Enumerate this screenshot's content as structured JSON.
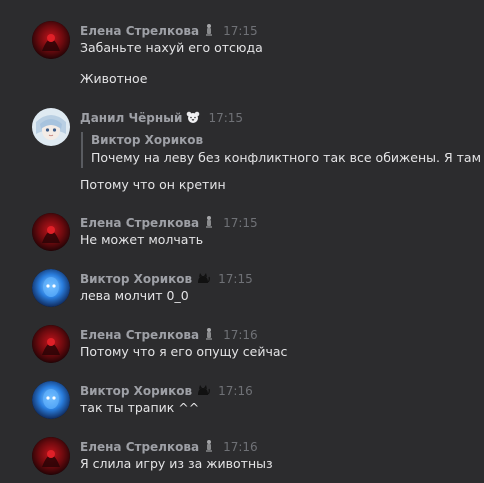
{
  "messages": [
    {
      "author": "Елена Стрелкова",
      "author_icon": "figurine-emoji",
      "time": "17:15",
      "avatar": "dark-red-hooded-figure-avatar",
      "lines": [
        "Забаньте нахуй его отсюда",
        "Животное"
      ]
    },
    {
      "author": "Данил Чёрный",
      "author_icon": "bear-face-emoji",
      "time": "17:15",
      "avatar": "anime-character-avatar",
      "reply": {
        "author": "Виктор Хориков",
        "text": "Почему на леву без конфликтного так все обижены. Я там ..."
      },
      "lines": [
        "Потому что он кретин"
      ]
    },
    {
      "author": "Елена Стрелкова",
      "author_icon": "figurine-emoji",
      "time": "17:15",
      "avatar": "dark-red-hooded-figure-avatar",
      "lines": [
        "Не может молчать"
      ]
    },
    {
      "author": "Виктор Хориков",
      "author_icon": "black-cat-emoji",
      "time": "17:15",
      "avatar": "blue-glowing-figure-avatar",
      "lines": [
        "лева молчит 0_0"
      ]
    },
    {
      "author": "Елена Стрелкова",
      "author_icon": "figurine-emoji",
      "time": "17:16",
      "avatar": "dark-red-hooded-figure-avatar",
      "lines": [
        "Потому что я его опущу сейчас"
      ]
    },
    {
      "author": "Виктор Хориков",
      "author_icon": "black-cat-emoji",
      "time": "17:16",
      "avatar": "blue-glowing-figure-avatar",
      "lines": [
        "так ты трапик ^^"
      ]
    },
    {
      "author": "Елена Стрелкова",
      "author_icon": "figurine-emoji",
      "time": "17:16",
      "avatar": "dark-red-hooded-figure-avatar",
      "lines": [
        "Я слила игру из за животныз"
      ]
    }
  ],
  "colors": {
    "background": "#2c2c2e",
    "author_name": "#9ea0a6",
    "timestamp": "#6f7176",
    "message_text": "#e4e4e6",
    "reply_bar": "#5a5c61"
  }
}
